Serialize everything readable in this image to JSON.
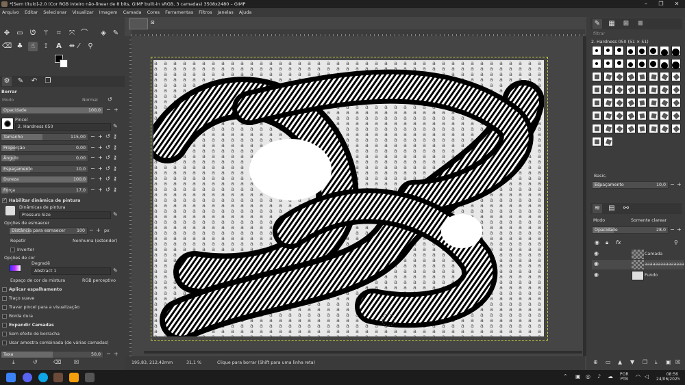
{
  "window": {
    "title": "*[Sem título]-2.0 (Cor RGB inteiro não-linear de 8 bits, GIMP built-in sRGB, 3 camadas) 3508x2480 – GIMP"
  },
  "menu": [
    "Arquivo",
    "Editar",
    "Selecionar",
    "Visualizar",
    "Imagem",
    "Camada",
    "Cores",
    "Ferramentas",
    "Filtros",
    "Janelas",
    "Ajuda"
  ],
  "tool_options": {
    "title": "Borrar",
    "mode_label": "Modo",
    "mode_value": "Normal",
    "opacity_label": "Opacidade",
    "opacity_value": "100,0",
    "brush_label": "Pincel",
    "brush_value": "2. Hardness 050",
    "sliders": [
      {
        "label": "Tamanho",
        "value": "115,00"
      },
      {
        "label": "Proporção",
        "value": "0,00"
      },
      {
        "label": "Ângulo",
        "value": "0,00"
      },
      {
        "label": "Espaçamento",
        "value": "10,0"
      },
      {
        "label": "Dureza",
        "value": "100,0"
      },
      {
        "label": "Força",
        "value": "17,0"
      }
    ],
    "dynamics_enabled": "Habilitar dinâmica de pintura",
    "dynamics_label": "Dinâmicas de pintura",
    "dynamics_value": "Pressure Size",
    "fade_header": "Opções de esmaecer",
    "fade_distance_label": "Distância para esmaecer",
    "fade_distance_value": "100",
    "fade_unit": "px",
    "repeat_label": "Repetir",
    "repeat_value": "Nenhuma (estender)",
    "invert_label": "Inverter",
    "color_header": "Opções de cor",
    "gradient_label": "Degradê",
    "gradient_value": "Abstract 1",
    "blend_space_label": "Espaço de cor da mistura",
    "blend_space_value": "RGB perceptivo",
    "checks": [
      {
        "label": "Aplicar espalhamento",
        "on": false
      },
      {
        "label": "Traço suave",
        "on": false
      },
      {
        "label": "Travar pincel para a visualização",
        "on": false
      },
      {
        "label": "Borda dura",
        "on": false
      },
      {
        "label": "Expandir Camadas",
        "on": false
      },
      {
        "label": "Sem efeito de borracha",
        "on": false
      },
      {
        "label": "Usar amostra combinada (de várias camadas)",
        "on": false
      }
    ],
    "rate_label": "Taxa",
    "rate_value": "50,0"
  },
  "statusbar": {
    "coords": "195,83, 212,42",
    "unit": "mm",
    "zoom": "31,1 %",
    "message": "Clique para borrar (Shift para uma linha reta)"
  },
  "brushes_panel": {
    "filter_placeholder": "filtrar",
    "current_brush": "2. Hardness 050 (51 × 51)",
    "preset": "Basic,",
    "spacing_label": "Espaçamento",
    "spacing_value": "10,0"
  },
  "layers_panel": {
    "mode_label": "Modo",
    "mode_value": "Somente clarear",
    "opacity_label": "Opacidade",
    "opacity_value": "28,0",
    "layers": [
      {
        "name": "Camada"
      },
      {
        "name": "aaaaaaaaaaaaaaa"
      },
      {
        "name": "Fundo"
      }
    ]
  },
  "taskbar": {
    "lang_top": "POR",
    "lang_bottom": "PTB",
    "time": "08:56",
    "date": "24/06/2025"
  }
}
